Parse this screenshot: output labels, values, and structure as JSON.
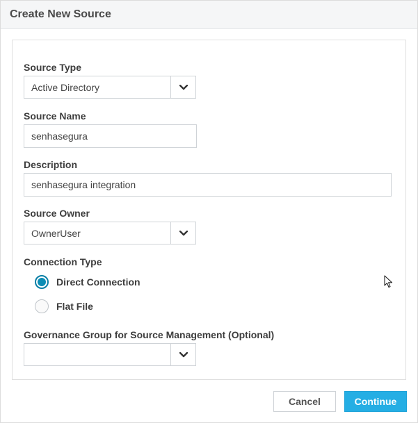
{
  "dialog": {
    "title": "Create New Source"
  },
  "form": {
    "source_type": {
      "label": "Source Type",
      "value": "Active Directory"
    },
    "source_name": {
      "label": "Source Name",
      "value": "senhasegura"
    },
    "description": {
      "label": "Description",
      "value": "senhasegura integration"
    },
    "source_owner": {
      "label": "Source Owner",
      "value": "OwnerUser"
    },
    "connection_type": {
      "label": "Connection Type",
      "options": [
        {
          "label": "Direct Connection",
          "selected": true
        },
        {
          "label": "Flat File",
          "selected": false
        }
      ]
    },
    "governance_group": {
      "label": "Governance Group for Source Management (Optional)",
      "value": ""
    }
  },
  "footer": {
    "cancel_label": "Cancel",
    "continue_label": "Continue"
  },
  "colors": {
    "accent": "#25aee4",
    "radio_checked": "#0c8db5"
  },
  "icons": {
    "dropdown": "chevron-down-icon",
    "cursor": "mouse-pointer-icon"
  }
}
